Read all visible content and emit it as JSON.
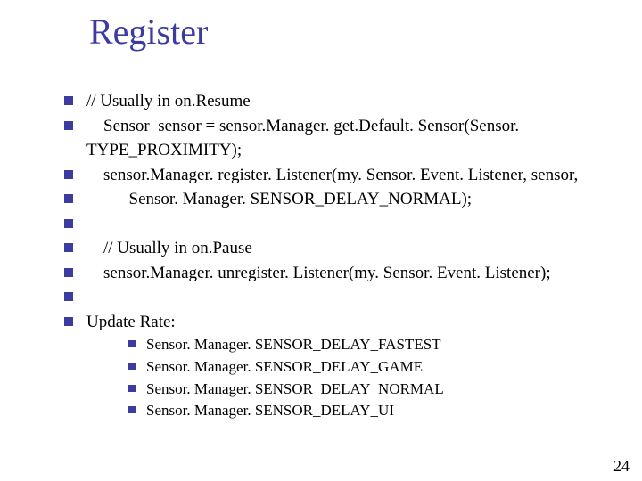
{
  "title": "Register",
  "lines": {
    "l0": "// Usually in on.Resume",
    "l1": "    Sensor  sensor = sensor.Manager. get.Default. Sensor(Sensor. TYPE_PROXIMITY);",
    "l2": "    sensor.Manager. register. Listener(my. Sensor. Event. Listener, sensor,",
    "l3": "          Sensor. Manager. SENSOR_DELAY_NORMAL);",
    "l4": "",
    "l5": "    // Usually in on.Pause",
    "l6": "    sensor.Manager. unregister. Listener(my. Sensor. Event. Listener);",
    "l7": "",
    "l8": "Update Rate:"
  },
  "sub": {
    "s0": "Sensor. Manager. SENSOR_DELAY_FASTEST",
    "s1": "Sensor. Manager. SENSOR_DELAY_GAME",
    "s2": "Sensor. Manager. SENSOR_DELAY_NORMAL",
    "s3": "Sensor. Manager. SENSOR_DELAY_UI"
  },
  "page_number": "24"
}
